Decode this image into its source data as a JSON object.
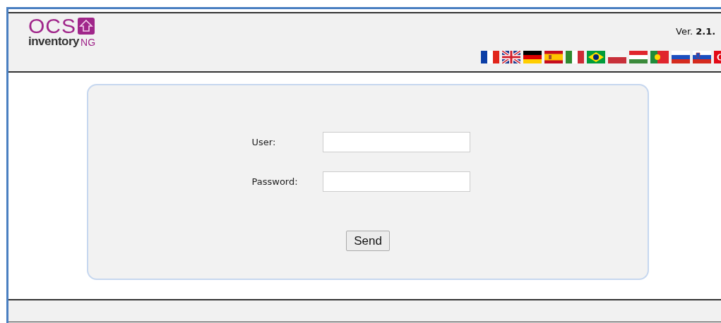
{
  "header": {
    "logo": {
      "top": "OCS",
      "bottom": "inventory",
      "suffix": "NG"
    },
    "version": "Ver. **2.1.**"
  },
  "login": {
    "fields": [
      {
        "label": "User:"
      },
      {
        "label": "Password:"
      }
    ],
    "submit": "Send"
  }
}
